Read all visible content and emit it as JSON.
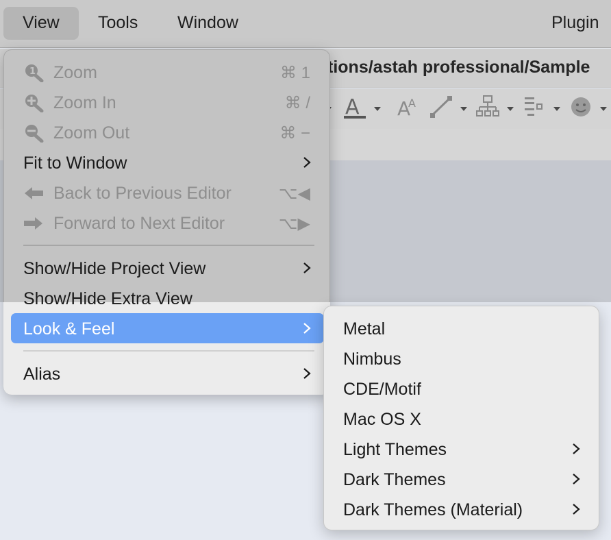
{
  "menubar": {
    "items": [
      {
        "label": "View",
        "active": true
      },
      {
        "label": "Tools",
        "active": false
      },
      {
        "label": "Window",
        "active": false
      },
      {
        "label": "Plugin",
        "active": false
      }
    ]
  },
  "window": {
    "title": "tions/astah professional/Sample"
  },
  "toolbar": {
    "icons": [
      "font-color-icon",
      "font-size-icon",
      "line-icon",
      "tree-icon",
      "align-icon",
      "face-icon"
    ]
  },
  "view_menu": {
    "items": [
      {
        "label": "Zoom",
        "shortcut": "⌘ 1",
        "icon": "zoom-icon",
        "enabled": false
      },
      {
        "label": "Zoom In",
        "shortcut": "⌘ /",
        "icon": "zoom-in-icon",
        "enabled": false
      },
      {
        "label": "Zoom Out",
        "shortcut": "⌘ −",
        "icon": "zoom-out-icon",
        "enabled": false
      },
      {
        "label": "Fit to Window",
        "submenu": true,
        "enabled": true
      },
      {
        "label": "Back to Previous Editor",
        "shortcut": "⌥◀",
        "icon": "arrow-left-icon",
        "enabled": false
      },
      {
        "label": "Forward to Next Editor",
        "shortcut": "⌥▶",
        "icon": "arrow-right-icon",
        "enabled": false
      },
      {
        "label": "Show/Hide Project View",
        "submenu": true,
        "enabled": true
      },
      {
        "label": "Show/Hide Extra View",
        "enabled": true
      },
      {
        "label": "Look & Feel",
        "submenu": true,
        "enabled": true,
        "highlighted": true
      },
      {
        "label": "Alias",
        "submenu": true,
        "enabled": true
      }
    ]
  },
  "look_and_feel_submenu": {
    "items": [
      {
        "label": "Metal",
        "submenu": false
      },
      {
        "label": "Nimbus",
        "submenu": false
      },
      {
        "label": "CDE/Motif",
        "submenu": false
      },
      {
        "label": "Mac OS X",
        "submenu": false
      },
      {
        "label": "Light Themes",
        "submenu": true
      },
      {
        "label": "Dark Themes",
        "submenu": true
      },
      {
        "label": "Dark Themes (Material)",
        "submenu": true
      }
    ]
  },
  "colors": {
    "highlight": "#6aa1f5",
    "disabled_text": "#8e8e8e",
    "menu_bg": "#ececec"
  }
}
